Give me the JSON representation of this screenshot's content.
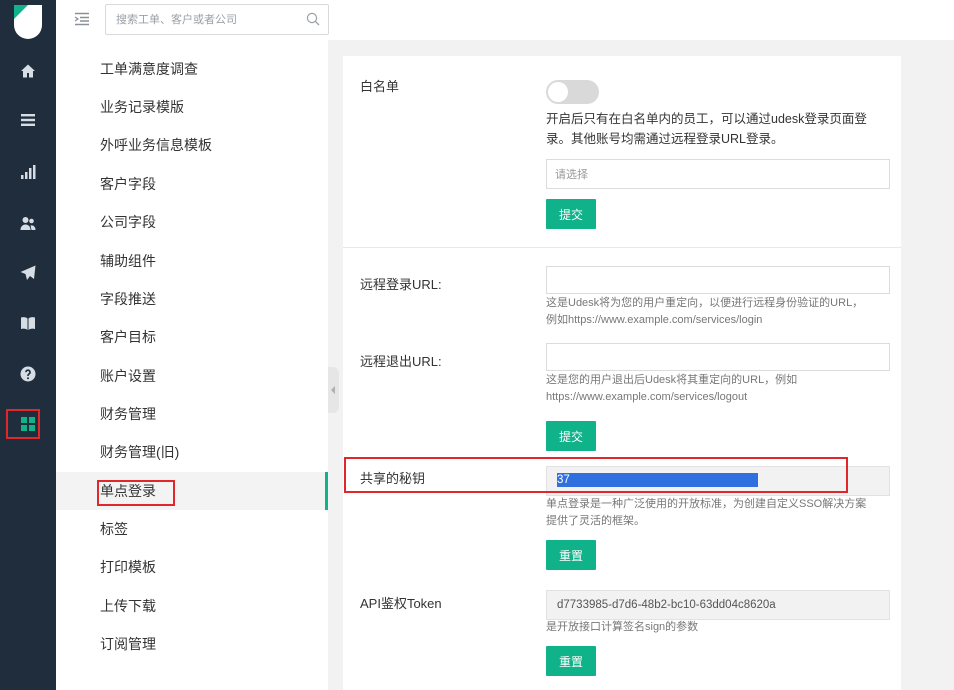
{
  "topbar": {
    "search_placeholder": "搜索工单、客户或者公司"
  },
  "rail": {
    "items": [
      {
        "icon": "home-icon"
      },
      {
        "icon": "list-icon"
      },
      {
        "icon": "bar-chart-icon"
      },
      {
        "icon": "users-icon"
      },
      {
        "icon": "send-icon"
      },
      {
        "icon": "book-icon"
      },
      {
        "icon": "help-icon"
      },
      {
        "icon": "apps-grid-icon",
        "active": true
      }
    ],
    "highlight_color": "#e0272c",
    "accent_color": "#10b28a"
  },
  "submenu": {
    "items": [
      {
        "label": "工单满意度调查"
      },
      {
        "label": "业务记录模版"
      },
      {
        "label": "外呼业务信息模板"
      },
      {
        "label": "客户字段"
      },
      {
        "label": "公司字段"
      },
      {
        "label": "辅助组件"
      },
      {
        "label": "字段推送"
      },
      {
        "label": "客户目标"
      },
      {
        "label": "账户设置"
      },
      {
        "label": "财务管理"
      },
      {
        "label": "财务管理(旧)"
      },
      {
        "label": "单点登录",
        "active": true
      },
      {
        "label": "标签"
      },
      {
        "label": "打印模板"
      },
      {
        "label": "上传下载"
      },
      {
        "label": "订阅管理"
      }
    ]
  },
  "whitelist": {
    "label": "白名单",
    "enabled": false,
    "desc_line1": "开启后只有在白名单内的员工，可以通过udesk登录页面登",
    "desc_line2": "录。其他账号均需通过远程登录URL登录。",
    "select_placeholder": "请选择",
    "submit": "提交"
  },
  "remote": {
    "login_label": "远程登录URL:",
    "login_value": "",
    "login_desc1": "这是Udesk将为您的用户重定向，以便进行远程身份验证的URL，",
    "login_desc2": "例如https://www.example.com/services/login",
    "logout_label": "远程退出URL:",
    "logout_value": "",
    "logout_desc1": "这是您的用户退出后Udesk将其重定向的URL，例如",
    "logout_desc2": "https://www.example.com/services/logout",
    "submit": "提交"
  },
  "secret": {
    "label": "共享的秘钥",
    "value": "37",
    "desc1": "单点登录是一种广泛使用的开放标准，为创建自定义SSO解决方案",
    "desc2": "提供了灵活的框架。",
    "reset": "重置"
  },
  "api": {
    "label": "API鉴权Token",
    "value": "d7733985-d7d6-48b2-bc10-63dd04c8620a",
    "desc": "是开放接口计算签名sign的参数",
    "reset": "重置"
  }
}
